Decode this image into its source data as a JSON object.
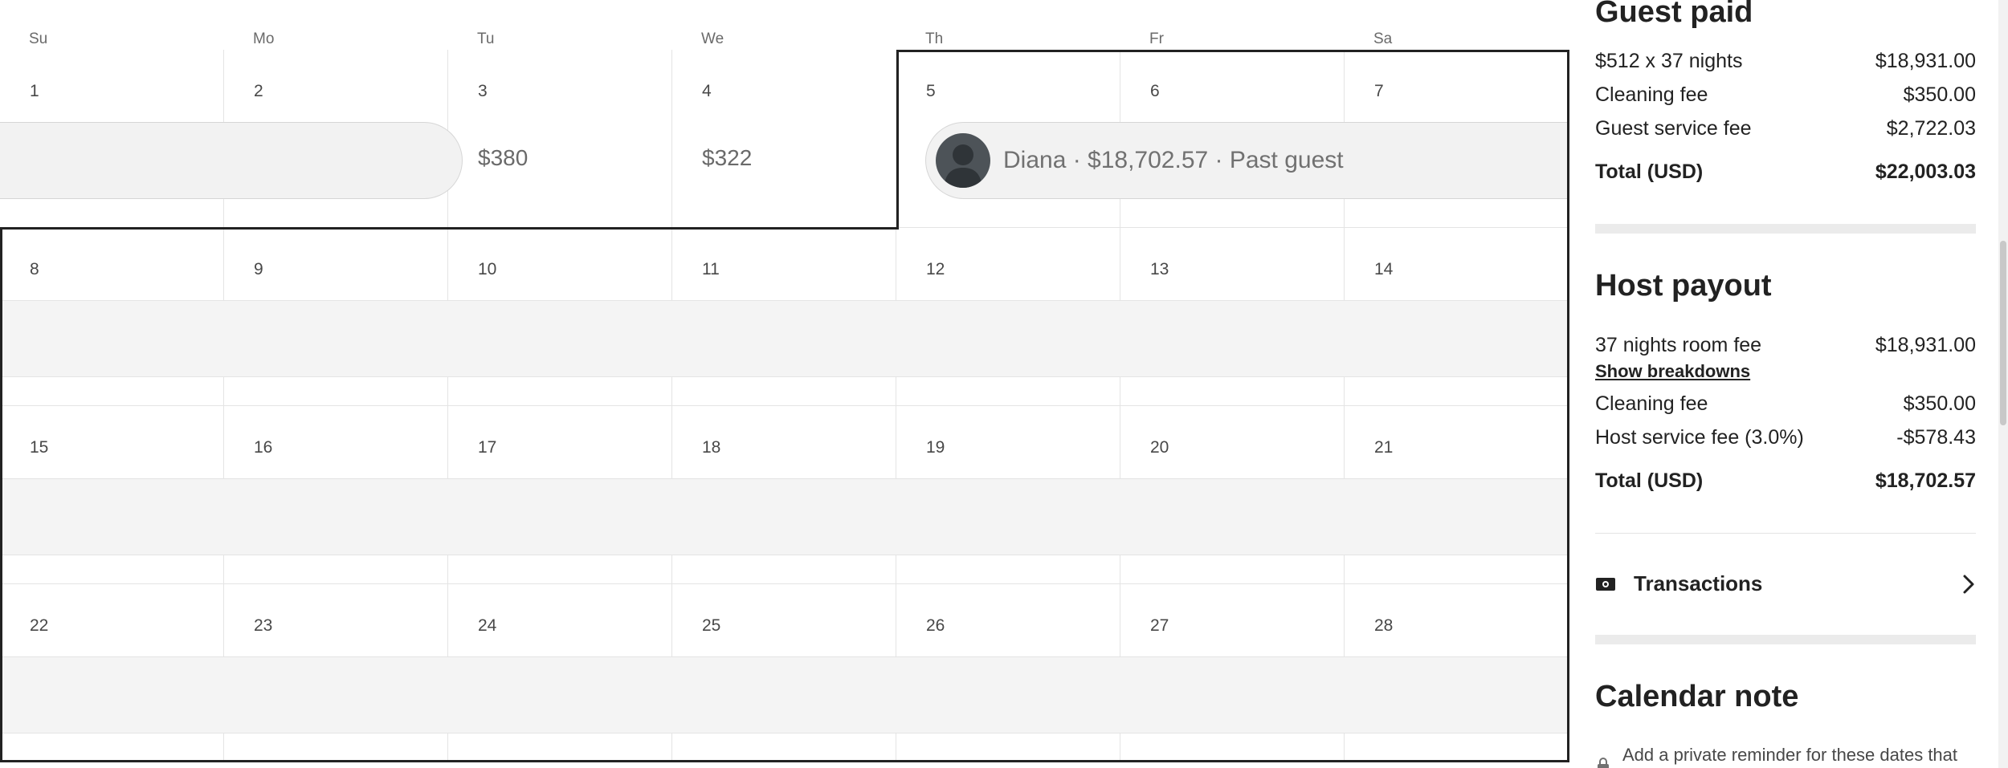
{
  "calendar": {
    "weekdays": [
      "Su",
      "Mo",
      "Tu",
      "We",
      "Th",
      "Fr",
      "Sa"
    ],
    "week1": {
      "days": [
        "1",
        "2",
        "3",
        "4",
        "5",
        "6",
        "7"
      ],
      "prices": {
        "tue": "$380",
        "wed": "$322"
      }
    },
    "week2": {
      "days": [
        "8",
        "9",
        "10",
        "11",
        "12",
        "13",
        "14"
      ]
    },
    "week3": {
      "days": [
        "15",
        "16",
        "17",
        "18",
        "19",
        "20",
        "21"
      ]
    },
    "week4": {
      "days": [
        "22",
        "23",
        "24",
        "25",
        "26",
        "27",
        "28"
      ]
    },
    "reservation": {
      "label": "Diana · $18,702.57 · Past guest"
    }
  },
  "guest_paid": {
    "title": "Guest paid",
    "lines": [
      {
        "label": "$512 x 37 nights",
        "value": "$18,931.00"
      },
      {
        "label": "Cleaning fee",
        "value": "$350.00"
      },
      {
        "label": "Guest service fee",
        "value": "$2,722.03"
      }
    ],
    "total_label": "Total (USD)",
    "total_value": "$22,003.03"
  },
  "host_payout": {
    "title": "Host payout",
    "room_fee_label": "37 nights room fee",
    "room_fee_value": "$18,931.00",
    "show_breakdowns": "Show breakdowns",
    "cleaning_label": "Cleaning fee",
    "cleaning_value": "$350.00",
    "service_label": "Host service fee (3.0%)",
    "service_value": "-$578.43",
    "total_label": "Total (USD)",
    "total_value": "$18,702.57"
  },
  "transactions": {
    "label": "Transactions",
    "icon": "money-icon"
  },
  "calendar_note": {
    "title": "Calendar note",
    "text": "Add a private reminder for these dates that"
  }
}
